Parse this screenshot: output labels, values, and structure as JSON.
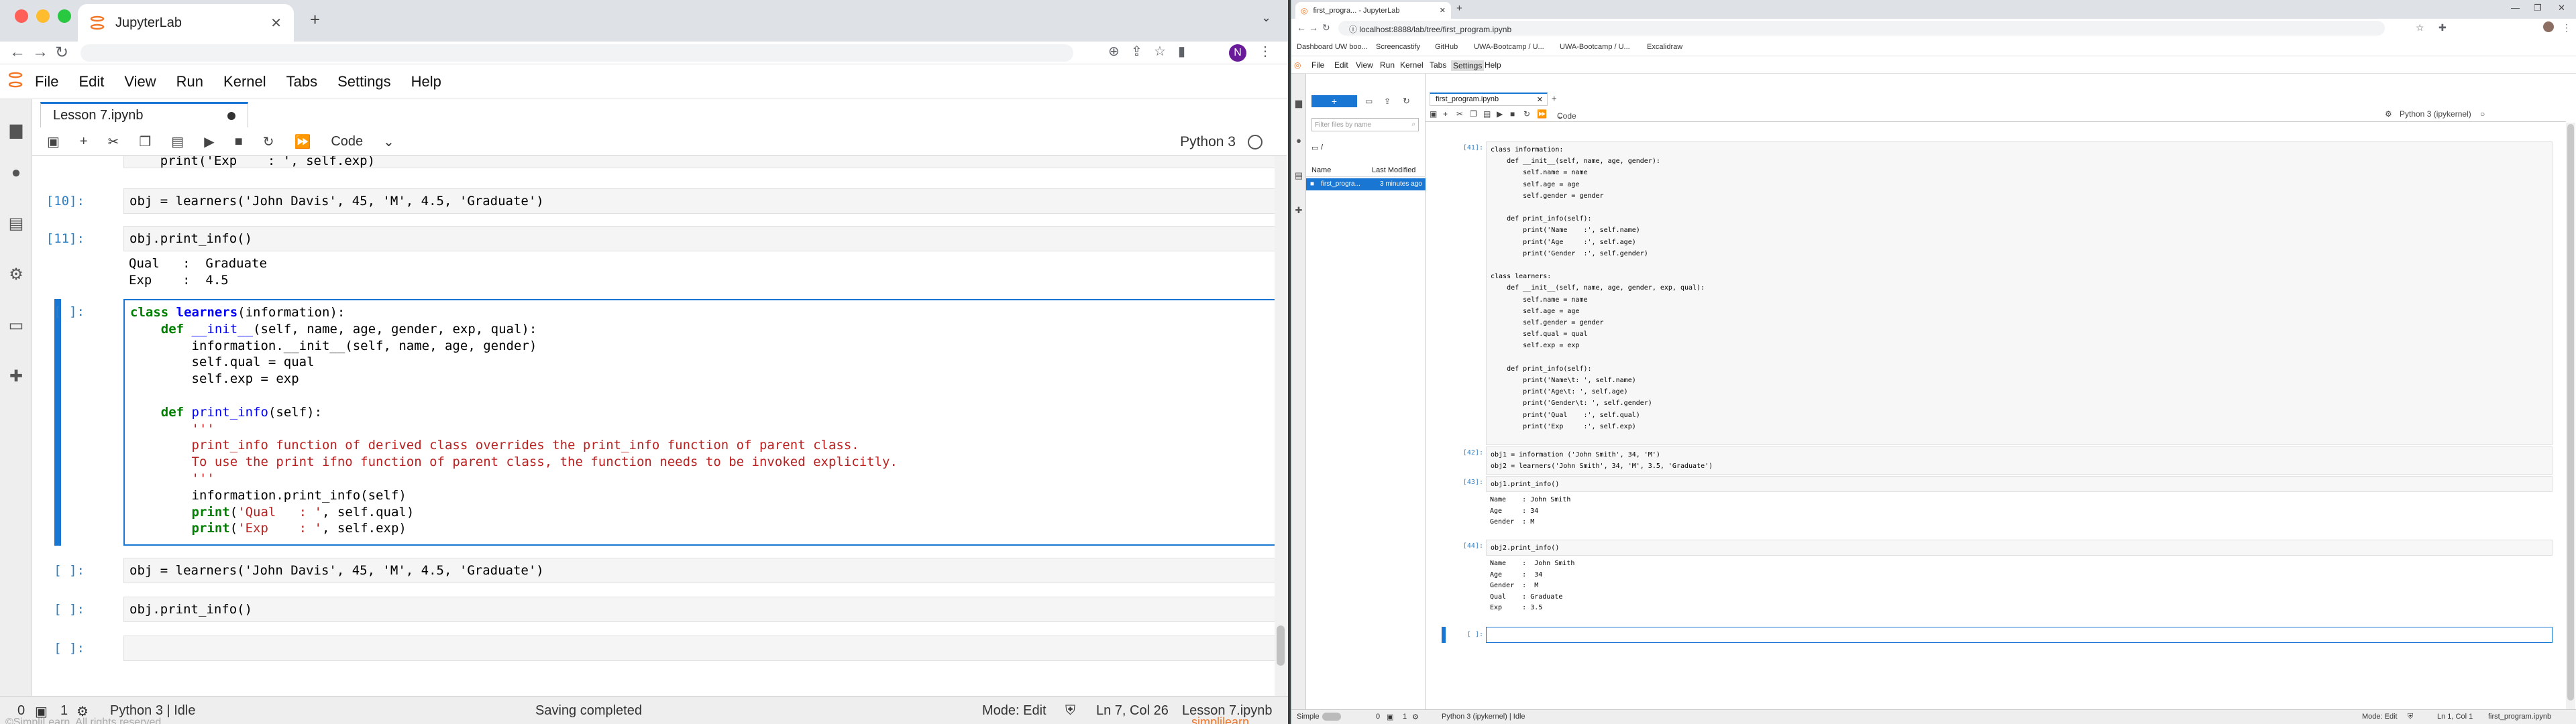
{
  "colors": {
    "brand": "#f37626",
    "accent": "#1976d2",
    "keyword": "#008000",
    "string": "#ba2121",
    "prompt": "#307fc1"
  },
  "left": {
    "tab_title": "JupyterLab",
    "menu": [
      "File",
      "Edit",
      "View",
      "Run",
      "Kernel",
      "Tabs",
      "Settings",
      "Help"
    ],
    "doc_tab": "Lesson 7.ipynb",
    "cell_type": "Code",
    "kernel": "Python 3",
    "avatar": "N",
    "cells": {
      "partial": {
        "code": "    print('Exp    : ', self.exp)"
      },
      "c10": {
        "prompt": "[10]:",
        "code": "obj = learners('John Davis', 45, 'M', 4.5, 'Graduate')"
      },
      "c11": {
        "prompt": "[11]:",
        "code": "obj.print_info()",
        "output": "Qual   :  Graduate\nExp    :  4.5"
      },
      "active": {
        "prompt": "[ ]:",
        "lines": [
          "class learners(information):",
          "    def __init__(self, name, age, gender, exp, qual):",
          "        information.__init__(self, name, age, gender)",
          "        self.qual = qual",
          "        self.exp = exp",
          "",
          "    def print_info(self):",
          "        '''",
          "        print_info function of derived class overrides the print_info function of parent class.",
          "        To use the print ifno function of parent class, the function needs to be invoked explicitly.",
          "        '''",
          "        information.print_info(self)",
          "        print('Qual   : ', self.qual)",
          "        print('Exp    : ', self.exp)"
        ]
      },
      "c_obj": {
        "prompt": "[ ]:",
        "code": "obj = learners('John Davis', 45, 'M', 4.5, 'Graduate')"
      },
      "c_print": {
        "prompt": "[ ]:",
        "code": "obj.print_info()"
      },
      "c_empty": {
        "prompt": "[ ]:",
        "code": ""
      }
    },
    "status": {
      "count1": "0",
      "count2": "1",
      "kernel": "Python 3 | Idle",
      "saving": "Saving completed",
      "mode": "Mode: Edit",
      "position": "Ln 7, Col 26",
      "file": "Lesson 7.ipynb",
      "bottom_left": "©SimpliLearn. All rights reserved",
      "bottom_right": "simplilearn"
    }
  },
  "right": {
    "tab_title": "first_progra... - JupyterLab",
    "url": "localhost:8888/lab/tree/first_program.ipynb",
    "bookmarks": [
      "Dashboard UW boo...",
      "Screencastify",
      "GitHub",
      "UWA-Bootcamp / U...",
      "UWA-Bootcamp / U...",
      "Excalidraw"
    ],
    "menu": [
      "File",
      "Edit",
      "View",
      "Run",
      "Kernel",
      "Tabs",
      "Settings",
      "Help"
    ],
    "file_filter_placeholder": "Filter files by name",
    "path": "/",
    "col_name": "Name",
    "col_modified": "Last Modified",
    "file_name": "first_progra...",
    "file_modified": "3 minutes ago",
    "doc_tab": "first_program.ipynb",
    "cell_type": "Code",
    "kernel": "Python 3 (ipykernel)",
    "cells": {
      "c41": {
        "prompt": "[41]:",
        "code": "class information:\n    def __init__(self, name, age, gender):\n        self.name = name\n        self.age = age\n        self.gender = gender\n\n    def print_info(self):\n        print('Name    :', self.name)\n        print('Age     :', self.age)\n        print('Gender  :', self.gender)\n\nclass learners:\n    def __init__(self, name, age, gender, exp, qual):\n        self.name = name\n        self.age = age\n        self.gender = gender\n        self.qual = qual\n        self.exp = exp\n\n    def print_info(self):\n        print('Name\\t: ', self.name)\n        print('Age\\t: ', self.age)\n        print('Gender\\t: ', self.gender)\n        print('Qual    :', self.qual)\n        print('Exp     :', self.exp)"
      },
      "c42": {
        "prompt": "[42]:",
        "code": "obj1 = information ('John Smith', 34, 'M')\nobj2 = learners('John Smith', 34, 'M', 3.5, 'Graduate')"
      },
      "c43": {
        "prompt": "[43]:",
        "code": "obj1.print_info()",
        "output": "Name    : John Smith\nAge     : 34\nGender  : M"
      },
      "c44": {
        "prompt": "[44]:",
        "code": "obj2.print_info()",
        "output": "Name    :  John Smith\nAge     :  34\nGender  :  M\nQual    : Graduate\nExp     : 3.5"
      },
      "c_new": {
        "prompt": "[ ]:"
      }
    },
    "status": {
      "mode_label": "Simple",
      "n1": "0",
      "n2": "1",
      "kernel": "Python 3 (ipykernel) | Idle",
      "mode": "Mode: Edit",
      "position": "Ln 1, Col 1",
      "file": "first_program.ipynb"
    }
  }
}
